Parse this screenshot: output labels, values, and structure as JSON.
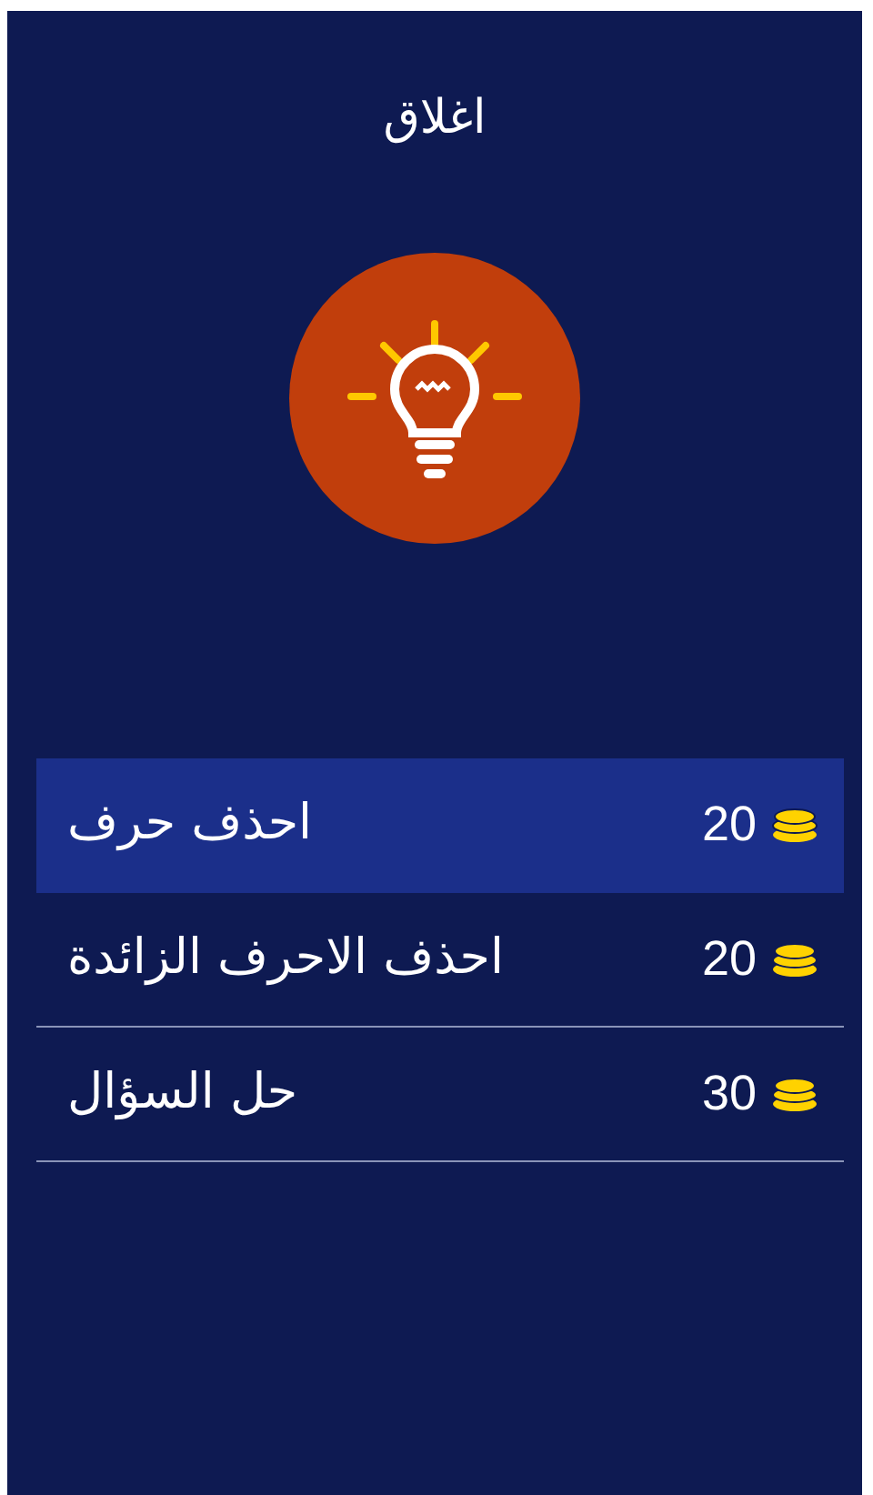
{
  "header": {
    "title": "اغلاق"
  },
  "hints": [
    {
      "label": "احذف حرف",
      "price": "20",
      "selected": true
    },
    {
      "label": "احذف الاحرف الزائدة",
      "price": "20",
      "selected": false
    },
    {
      "label": "حل السؤال",
      "price": "30",
      "selected": false
    }
  ]
}
